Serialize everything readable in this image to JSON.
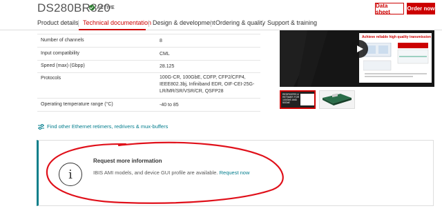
{
  "header": {
    "part_number": "DS280BR820",
    "status": "ACTIVE",
    "datasheet_label": "Data sheet",
    "order_label": "Order now"
  },
  "tabs": [
    {
      "label": "Product details",
      "active": false
    },
    {
      "label": "Technical documentation",
      "active": true
    },
    {
      "label": "Design & development",
      "active": false
    },
    {
      "label": "Ordering & quality",
      "active": false
    },
    {
      "label": "Support & training",
      "active": false
    }
  ],
  "specs": [
    {
      "key": "Number of channels",
      "value": "8"
    },
    {
      "key": "Input compatibility",
      "value": "CML"
    },
    {
      "key": "Speed (max) (Gbpp)",
      "value": "28.125"
    },
    {
      "key": "Protocols",
      "value": "100G-CR, 100GbE, CDFP, CFP2/CFP4, IEEE802.3bj, Infiniband EDR, OIF-CEI-25G-LR/MR/SR/VSR/CR, QSFP28"
    },
    {
      "key": "Operating temperature range (°C)",
      "value": "-40 to 85"
    }
  ],
  "video": {
    "slide_title": "Achieve reliable high quality transmission"
  },
  "thumbnail": {
    "caption": "REDRIVERS & RETIMER FOR 100GbE AND 50GbE"
  },
  "link": {
    "label": "Find other Ethernet retimers, redrivers & mux-buffers"
  },
  "info_card": {
    "title": "Request more information",
    "text": "IBIS AMI models, and device GUI profile are available.",
    "link_label": "Request now"
  },
  "colors": {
    "brand_red": "#cc0000",
    "link_teal": "#007c8c",
    "annotation_red": "#e0101a"
  }
}
